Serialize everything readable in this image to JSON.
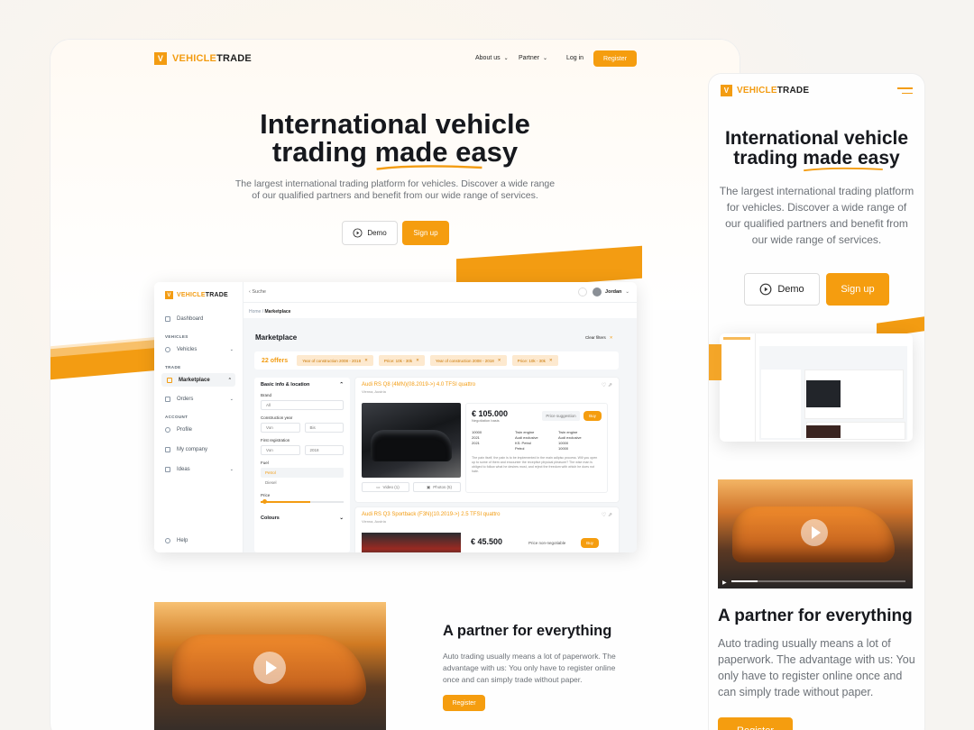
{
  "brand": {
    "mark": "V",
    "word1": "VEHICLE",
    "word2": "TRADE"
  },
  "colors": {
    "accent": "#f39c12",
    "text": "#16181d"
  },
  "nav": {
    "about": "About us",
    "partner": "Partner",
    "login": "Log in",
    "register": "Register"
  },
  "hero": {
    "title_line1": "International vehicle",
    "title_line2_plain": "trading",
    "title_line2_highlight": "made easy",
    "subtitle": "The largest international trading platform for vehicles. Discover a wide range of our qualified partners and benefit from our wide range of services.",
    "demo": "Demo",
    "signup": "Sign up"
  },
  "dashboard": {
    "search": "Suche",
    "user": "Jordan",
    "breadcrumb_home": "Home",
    "breadcrumb_current": "Marketplace",
    "sidebar": {
      "dashboard": "Dashboard",
      "section_vehicles": "VEHICLES",
      "vehicles": "Vehicles",
      "section_trade": "TRADE",
      "marketplace": "Marketplace",
      "orders": "Orders",
      "section_account": "ACCOUNT",
      "profile": "Profile",
      "company": "My company",
      "ideas": "Ideas",
      "help": "Help"
    },
    "marketplace_title": "Marketplace",
    "clear_filters": "Clear filters",
    "offers": "22 offers",
    "chips": [
      "Year of construction 2008 - 2018",
      "Price: 10k - 30k",
      "Year of construction 2008 - 2018",
      "Price: 10k - 30k"
    ],
    "filters": {
      "title": "Basic info & location",
      "brand": "Brand",
      "brand_val": "All",
      "construction_year": "Construction year",
      "from": "Von",
      "to": "Bis",
      "first_registration": "First registration",
      "reg_from": "Von",
      "reg_to": "2018",
      "fuel": "Fuel",
      "fuel_opt1": "Petrol",
      "fuel_opt2": "Diesel",
      "price": "Price",
      "colours": "Colours"
    },
    "listings": [
      {
        "title": "Audi RS Q8 (4MN)(08.2019->) 4.0 TFSI quattro",
        "location": "Vienna, Austria",
        "price": "€ 105.000",
        "price_note": "Negotiation basis",
        "price_btn": "Price suggestion",
        "buy": "Buy",
        "specs": [
          [
            "10000",
            "Twin engine",
            "Twin engine"
          ],
          [
            "2021",
            "Audi exclusive",
            "Audi exclusive"
          ],
          [
            "2021",
            "KS: Petrol",
            "10000"
          ],
          [
            "",
            "Petrol",
            "10000"
          ]
        ],
        "desc": "The pain itself, the pain is to be implemented in the main adipisc process. Will you open up to some of them and encounter the receptive physical pleasure? The wise man is obliged to follow what he desires most, and reject the freedom with which he does not hate.",
        "video": "Video (1)",
        "photos": "Photos (5)"
      },
      {
        "title": "Audi RS Q3 Sportback (F3N)(10.2019->) 2.5 TFSI quattro",
        "location": "Vienna, Austria",
        "price": "€ 45.500",
        "price_note": "Negotiation basis",
        "price_btn": "Price non-negotiable",
        "buy": "Buy"
      }
    ]
  },
  "partner": {
    "title": "A partner for everything",
    "text": "Auto trading usually means a lot of paperwork. The advantage with us: You only have to register online once and can simply trade without paper.",
    "register": "Register"
  }
}
